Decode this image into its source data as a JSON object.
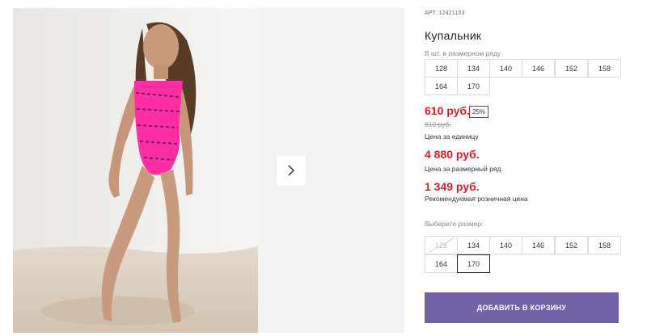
{
  "product": {
    "art_label": "АРТ.",
    "art_number": "12421153",
    "title": "Купальник"
  },
  "gallery": {
    "image_alt": "girl in pink swimsuit",
    "next_icon": "chevron-right-icon"
  },
  "size_row": {
    "label": "В шт. в размерном ряду",
    "sizes": [
      "128",
      "134",
      "140",
      "146",
      "152",
      "158",
      "164",
      "170"
    ]
  },
  "pricing": {
    "unit_price": "610 руб.",
    "discount": "25%",
    "old_price": "810 руб.",
    "unit_label": "Цена за единицу",
    "row_price": "4 880 руб.",
    "row_label": "Цена за размерный ряд",
    "retail_price": "1 349 руб.",
    "retail_label": "Рекомендуемая розничная цена"
  },
  "size_choice": {
    "label": "Выберите размер:",
    "sizes": [
      "128",
      "134",
      "140",
      "146",
      "152",
      "158",
      "164",
      "170"
    ],
    "disabled": "128",
    "selected": "170"
  },
  "cart": {
    "button_label": "ДОБАВИТЬ В КОРЗИНУ"
  },
  "colors": {
    "price_red": "#e0192a",
    "button_purple": "#7462a6"
  }
}
